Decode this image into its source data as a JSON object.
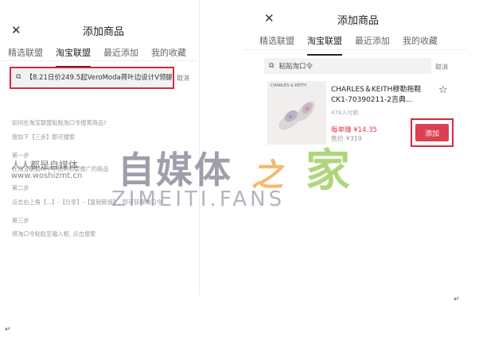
{
  "left": {
    "close": "✕",
    "title": "添加商品",
    "tabs": [
      {
        "label": "精选联盟"
      },
      {
        "label": "淘宝联盟"
      },
      {
        "label": "最近添加"
      },
      {
        "label": "我的收藏"
      }
    ],
    "search_value": "【8.21日价249.5起VeroModa荷叶边设计V领腿...",
    "cancel": "取消",
    "help": {
      "q": "如何在淘宝联盟粘贴淘口令搜索商品?",
      "intro": "按如下【三步】即可搜索",
      "step1": "第一步",
      "step1_text": "在淘宝联盟APP中找到你要推广的商品",
      "step2": "第二步",
      "step2_text": "点击右上角【...】-【分享】-【复制链接】, 即可获得淘口令",
      "step3": "第三步",
      "step3_text": "将淘口令粘贴至输入框, 点击搜索"
    }
  },
  "right": {
    "close": "✕",
    "title": "添加商品",
    "tabs": [
      {
        "label": "精选联盟"
      },
      {
        "label": "淘宝联盟"
      },
      {
        "label": "最近添加"
      },
      {
        "label": "我的收藏"
      }
    ],
    "search_placeholder": "粘贴淘口令",
    "cancel": "取消",
    "product": {
      "brand_tag": "CHARLES & KEITH",
      "name": "CHARLES＆KEITH穆勒拖鞋CK1-70390211-2吉典...",
      "sold": "478人付款",
      "earn": "每单赚 ¥14.35",
      "price": "售价 ¥319",
      "add": "添加"
    }
  },
  "watermark": {
    "brand": "自媒体",
    "zhi": "之",
    "jia": "家",
    "domain": "ZIMEITI.FANS",
    "site_name": "人人都是自媒体",
    "site_url": "www.woshizmt.cn"
  },
  "return_marks": [
    "↵",
    "↵"
  ],
  "colors": {
    "accent": "#dd3e52",
    "highlight": "#d8283d"
  }
}
